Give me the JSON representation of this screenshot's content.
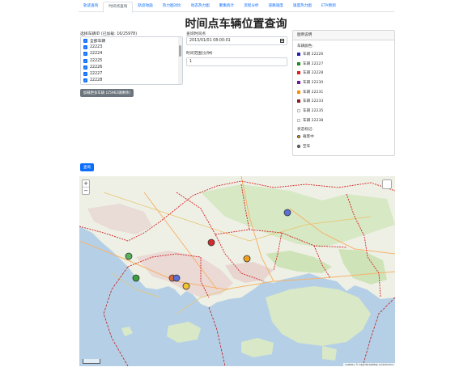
{
  "tabs": [
    {
      "label": "轨迹查询",
      "active": false
    },
    {
      "label": "时间点查询",
      "active": true
    },
    {
      "label": "轨迹动画",
      "active": false
    },
    {
      "label": "热力图对比",
      "active": false
    },
    {
      "label": "动态热力图",
      "active": false
    },
    {
      "label": "聚集统计",
      "active": false
    },
    {
      "label": "流程分析",
      "active": false
    },
    {
      "label": "道路速度",
      "active": false
    },
    {
      "label": "速度热力图",
      "active": false
    },
    {
      "label": "ETA预测",
      "active": false
    }
  ],
  "page_title": "时间点车辆位置查询",
  "vehicle_select": {
    "label": "选择车辆ID (已加载: 16/25978)",
    "items": [
      {
        "label": "全部车辆",
        "checked": true
      },
      {
        "label": "22223",
        "checked": true
      },
      {
        "label": "22224",
        "checked": true
      },
      {
        "label": "22225",
        "checked": true
      },
      {
        "label": "22226",
        "checked": true
      },
      {
        "label": "22227",
        "checked": true
      },
      {
        "label": "22228",
        "checked": true
      }
    ],
    "load_more_label": "加载更多车辆 (25962辆剩余)"
  },
  "query_time": {
    "label": "查询时间点",
    "value": "2013/01/01 08:00:01"
  },
  "time_range": {
    "label": "时间范围(分钟)",
    "value": "1"
  },
  "legend": {
    "title": "图例说明",
    "vehicle_color_label": "车辆颜色:",
    "vehicles": [
      {
        "label": "车辆 22226",
        "color": "#1f1fb4",
        "outline": false
      },
      {
        "label": "车辆 22227",
        "color": "#1e8c1e",
        "outline": false
      },
      {
        "label": "车辆 22228",
        "color": "#e31a1c",
        "outline": false
      },
      {
        "label": "车辆 22230",
        "color": "#6a1b9a",
        "outline": false
      },
      {
        "label": "车辆 22231",
        "color": "#ff8c00",
        "outline": false
      },
      {
        "label": "车辆 22233",
        "color": "#8b1a1a",
        "outline": false
      },
      {
        "label": "车辆 22235",
        "color": "#ffffff",
        "outline": true
      },
      {
        "label": "车辆 22238",
        "color": "#ffffff",
        "outline": true
      }
    ],
    "status_label": "状态标记:",
    "statuses": [
      {
        "label": "载客中",
        "color": "#f5b400"
      },
      {
        "label": "空车",
        "color": "#777777"
      }
    ]
  },
  "query_button": "查询",
  "map": {
    "zoom_in": "+",
    "zoom_out": "−",
    "attribution": "Leaflet | © OpenStreetMap contributors",
    "markers": [
      {
        "vehicle": "22226",
        "color": "#5b6fd6"
      },
      {
        "vehicle": "22227",
        "color": "#58b258"
      },
      {
        "vehicle": "22227",
        "color": "#3d9e3d"
      },
      {
        "vehicle": "22228",
        "color": "#d12b2b"
      },
      {
        "vehicle": "22228",
        "color": "#e3683a"
      },
      {
        "vehicle": "22230",
        "color": "#5b6fd6"
      },
      {
        "vehicle": "22231",
        "color": "#f0a020"
      },
      {
        "vehicle": "22233",
        "color": "#f2c230"
      }
    ]
  }
}
